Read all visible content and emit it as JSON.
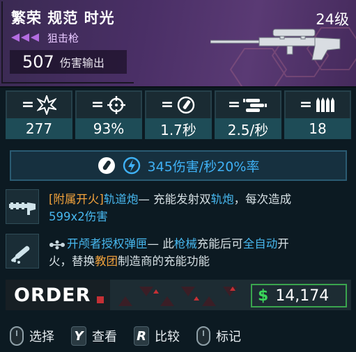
{
  "item": {
    "name": "繁荣 规范 时光",
    "level": "24级",
    "type": "狙击枪",
    "damage_value": "507",
    "damage_label": "伤害输出"
  },
  "stats": [
    {
      "icon": "burst-damage-icon",
      "value": "277"
    },
    {
      "icon": "crosshair-accuracy-icon",
      "value": "93%"
    },
    {
      "icon": "reload-time-icon",
      "value": "1.7秒"
    },
    {
      "icon": "fire-rate-icon",
      "value": "2.5/秒"
    },
    {
      "icon": "magazine-icon",
      "value": "18"
    }
  ],
  "dps": {
    "text": "345伤害/秒",
    "chance": "20%率",
    "colors": {
      "electric": "#3fb1f5"
    }
  },
  "perks": [
    {
      "name": "[附属开火]",
      "name2": "轨道炮",
      "desc1": "— 充能发射双",
      "desc_hl": "轨炮",
      "desc2": "，每次造成",
      "line2": "599x2伤害"
    },
    {
      "name": "开颅者授权弹匣",
      "desc1": "— 此",
      "hl1": "枪械",
      "desc2": "充能后可",
      "hl2": "全自动",
      "desc3": "开",
      "line2a": "火，替换",
      "hl3": "教团",
      "line2b": "制造商的充能功能"
    }
  ],
  "manufacturer": "ORDER",
  "price": {
    "symbol": "$",
    "amount": "14,174"
  },
  "controls": [
    {
      "key": "mouse-left",
      "label": "选择"
    },
    {
      "key": "Y",
      "label": "查看"
    },
    {
      "key": "R",
      "label": "比较"
    },
    {
      "key": "mouse-right",
      "label": "标记"
    }
  ]
}
